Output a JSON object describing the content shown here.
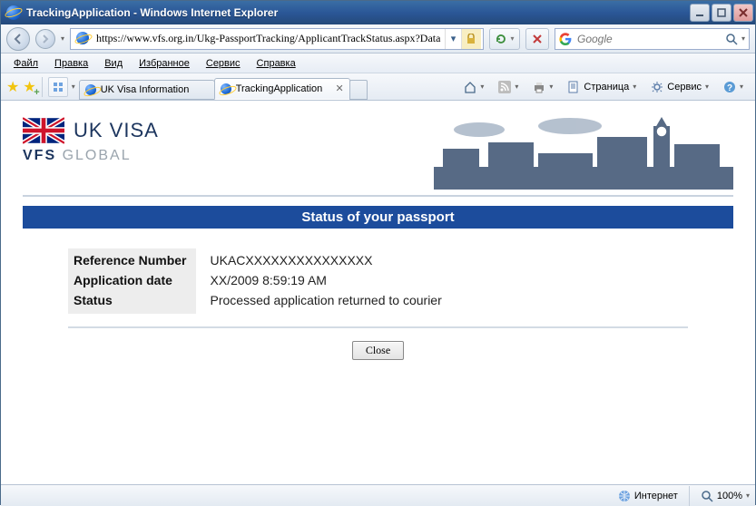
{
  "window": {
    "title": "TrackingApplication - Windows Internet Explorer"
  },
  "address_bar": {
    "url": "https://www.vfs.org.in/Ukg-PassportTracking/ApplicantTrackStatus.aspx?Data"
  },
  "search": {
    "placeholder": "Google"
  },
  "menu": {
    "file": "Файл",
    "edit": "Правка",
    "view": "Вид",
    "favorites": "Избранное",
    "tools": "Сервис",
    "help": "Справка"
  },
  "tabs": [
    {
      "title": "UK Visa Information",
      "active": false
    },
    {
      "title": "TrackingApplication",
      "active": true
    }
  ],
  "command": {
    "page": "Страница",
    "service": "Сервис"
  },
  "status": {
    "zone": "Интернет",
    "zoom": "100%"
  },
  "page": {
    "brand_line1": "UK VISA",
    "brand_line2_a": "VFS",
    "brand_line2_b": "GLOBAL",
    "banner": "Status of your passport",
    "labels": {
      "ref": "Reference Number",
      "appdate": "Application date",
      "status": "Status"
    },
    "values": {
      "ref_prefix": "UKAC",
      "ref_hidden": "XXXXXXXXXXXXXXX",
      "appdate": "/2009 8:59:19 AM",
      "status": "Processed application returned to courier"
    },
    "close_btn": "Close"
  }
}
